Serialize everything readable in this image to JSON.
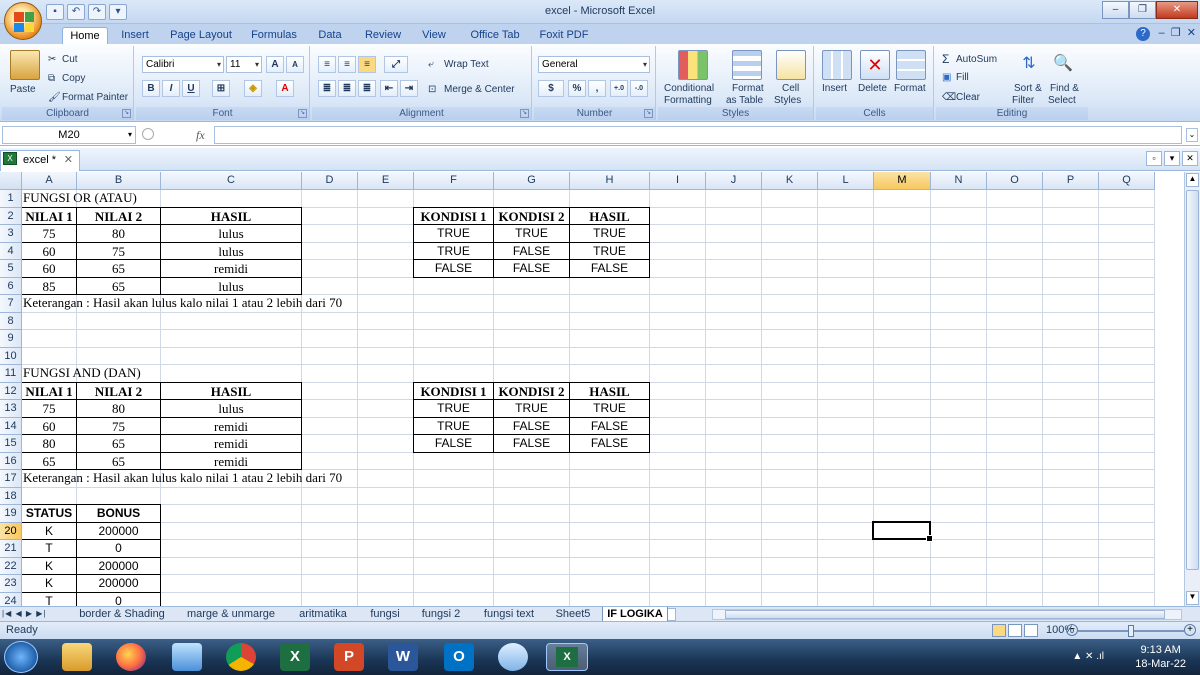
{
  "window": {
    "title": "excel - Microsoft Excel"
  },
  "ribbon_tabs": [
    "Home",
    "Insert",
    "Page Layout",
    "Formulas",
    "Data",
    "Review",
    "View",
    "Office Tab",
    "Foxit PDF"
  ],
  "clipboard": {
    "paste": "Paste",
    "cut": "Cut",
    "copy": "Copy",
    "format_painter": "Format Painter",
    "label": "Clipboard"
  },
  "font": {
    "name": "Calibri",
    "size": "11",
    "label": "Font",
    "bold": "B",
    "italic": "I",
    "underline": "U",
    "grow": "A",
    "shrink": "A"
  },
  "alignment": {
    "wrap": "Wrap Text",
    "merge": "Merge & Center",
    "label": "Alignment"
  },
  "number": {
    "format": "General",
    "currency": "$",
    "percent": "%",
    "comma": ",",
    "label": "Number"
  },
  "styles": {
    "conditional": "Conditional",
    "formatting": "Formatting",
    "format_as": "Format",
    "as_table": "as Table",
    "cell": "Cell",
    "cell_styles": "Styles",
    "label": "Styles"
  },
  "cells": {
    "insert": "Insert",
    "delete": "Delete",
    "format": "Format",
    "label": "Cells"
  },
  "editing": {
    "autosum": "AutoSum",
    "fill": "Fill",
    "clear": "Clear",
    "sort": "Sort &",
    "filter": "Filter",
    "find": "Find &",
    "select": "Select",
    "label": "Editing"
  },
  "formula_bar": {
    "name_box": "M20",
    "fx": "fx",
    "formula": ""
  },
  "doc_tab": {
    "name": "excel *"
  },
  "columns": [
    "A",
    "B",
    "C",
    "D",
    "E",
    "F",
    "G",
    "H",
    "I",
    "J",
    "K",
    "L",
    "M",
    "N",
    "O",
    "P",
    "Q"
  ],
  "rows": [
    "1",
    "2",
    "3",
    "4",
    "5",
    "6",
    "7",
    "8",
    "9",
    "10",
    "11",
    "12",
    "13",
    "14",
    "15",
    "16",
    "17",
    "18",
    "19",
    "20",
    "21",
    "22",
    "23",
    "24"
  ],
  "selection": {
    "column": "M",
    "row": "20"
  },
  "or_section": {
    "title": "FUNGSI OR (ATAU)",
    "headers": [
      "NILAI 1",
      "NILAI 2",
      "HASIL"
    ],
    "rows": [
      [
        "75",
        "80",
        "lulus"
      ],
      [
        "60",
        "75",
        "lulus"
      ],
      [
        "60",
        "65",
        "remidi"
      ],
      [
        "85",
        "65",
        "lulus"
      ]
    ],
    "note": "Keterangan : Hasil akan lulus kalo nilai 1 atau 2 lebih dari 70",
    "truth_headers": [
      "KONDISI 1",
      "KONDISI 2",
      "HASIL"
    ],
    "truth_rows": [
      [
        "TRUE",
        "TRUE",
        "TRUE"
      ],
      [
        "TRUE",
        "FALSE",
        "TRUE"
      ],
      [
        "FALSE",
        "FALSE",
        "FALSE"
      ]
    ]
  },
  "and_section": {
    "title": "FUNGSI AND (DAN)",
    "headers": [
      "NILAI 1",
      "NILAI 2",
      "HASIL"
    ],
    "rows": [
      [
        "75",
        "80",
        "lulus"
      ],
      [
        "60",
        "75",
        "remidi"
      ],
      [
        "80",
        "65",
        "remidi"
      ],
      [
        "65",
        "65",
        "remidi"
      ]
    ],
    "note": "Keterangan : Hasil akan lulus kalo nilai 1 atau 2 lebih dari 70",
    "truth_headers": [
      "KONDISI 1",
      "KONDISI 2",
      "HASIL"
    ],
    "truth_rows": [
      [
        "TRUE",
        "TRUE",
        "TRUE"
      ],
      [
        "TRUE",
        "FALSE",
        "FALSE"
      ],
      [
        "FALSE",
        "FALSE",
        "FALSE"
      ]
    ]
  },
  "bonus_section": {
    "headers": [
      "STATUS",
      "BONUS"
    ],
    "rows": [
      [
        "K",
        "200000"
      ],
      [
        "T",
        "0"
      ],
      [
        "K",
        "200000"
      ],
      [
        "K",
        "200000"
      ],
      [
        "T",
        "0"
      ]
    ]
  },
  "sheet_tabs": [
    "border & Shading",
    "marge & unmarge",
    "aritmatika",
    "fungsi",
    "fungsi 2",
    "fungsi text",
    "Sheet5",
    "IF LOGIKA"
  ],
  "active_sheet": "IF LOGIKA",
  "status": {
    "ready": "Ready",
    "zoom": "100%"
  },
  "taskbar": {
    "time": "9:13 AM",
    "date": "18-Mar-22"
  }
}
